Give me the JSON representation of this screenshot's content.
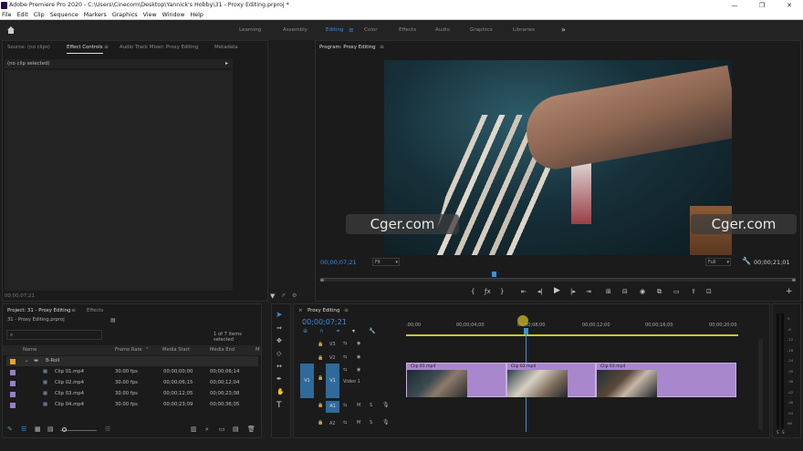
{
  "titlebar": {
    "title": "Adobe Premiere Pro 2020 - C:\\Users\\Cinecom\\Desktop\\Yannick's Hobby\\31 - Proxy Editing.prproj *",
    "minimize": "—",
    "maximize": "❐",
    "close": "✕"
  },
  "menu": [
    "File",
    "Edit",
    "Clip",
    "Sequence",
    "Markers",
    "Graphics",
    "View",
    "Window",
    "Help"
  ],
  "workspaces": {
    "learning": "Learning",
    "assembly": "Assembly",
    "editing": "Editing",
    "color": "Color",
    "effects": "Effects",
    "audio": "Audio",
    "graphics": "Graphics",
    "libraries": "Libraries",
    "more": "»"
  },
  "source_panel": {
    "tab_source": "Source: (no clips)",
    "tab_effect_controls": "Effect Controls",
    "tab_audio_mixer": "Audio Track Mixer: Proxy Editing",
    "tab_metadata": "Metadata",
    "no_clip": "(no clip selected)",
    "timecode": "00;00;07;21"
  },
  "program": {
    "tab": "Program: Proxy Editing",
    "timecode_left": "00;00;07;21",
    "fit": "Fit",
    "quality": "Full",
    "timecode_right": "00;00;21;01",
    "watermark": "Cger.com",
    "watermark2": "Cger.com",
    "playhead_fraction": 0.36
  },
  "project": {
    "tab_project": "Project: 31 - Proxy Editing",
    "tab_effects": "Effects",
    "filename": "31 - Proxy Editing.prproj",
    "item_count": "1 of 7 items selected",
    "columns": [
      "Name",
      "Frame Rate",
      "Media Start",
      "Media End",
      "M"
    ],
    "bin": "B-Roll",
    "rows": [
      {
        "name": "Clip 01.mp4",
        "fps": "30.00 fps",
        "start": "00;00;00;00",
        "end": "00;00;06;14"
      },
      {
        "name": "Clip 02.mp4",
        "fps": "30.00 fps",
        "start": "00;00;06;15",
        "end": "00;00;12;04"
      },
      {
        "name": "Clip 03.mp4",
        "fps": "30.00 fps",
        "start": "00;00;12;05",
        "end": "00;00;23;08"
      },
      {
        "name": "Clip 04.mp4",
        "fps": "30.00 fps",
        "start": "00;00;23;09",
        "end": "00;00;36;05"
      }
    ]
  },
  "timeline": {
    "tab": "Proxy Editing",
    "timecode": "00;00;07;21",
    "ruler": [
      ":00;00",
      "00;00;04;00",
      "00;00;08;00",
      "00;00;12;00",
      "00;00;16;00",
      "00;00;20;00"
    ],
    "tracks": {
      "v3": "V3",
      "v2": "V2",
      "v1": "V1",
      "v1src": "V1",
      "video1": "Video 1",
      "a1": "A1",
      "a1src": "A1",
      "a2": "A2",
      "m": "M",
      "s": "S"
    },
    "clips": [
      "Clip 01.mp4",
      "Clip 02.mp4",
      "Clip 03.mp4"
    ]
  },
  "meter": {
    "labels": [
      "0",
      "-6",
      "-12",
      "-18",
      "-24",
      "-30",
      "-36",
      "-42",
      "-48",
      "-54",
      "dB"
    ],
    "s1": "S",
    "s2": "S"
  }
}
